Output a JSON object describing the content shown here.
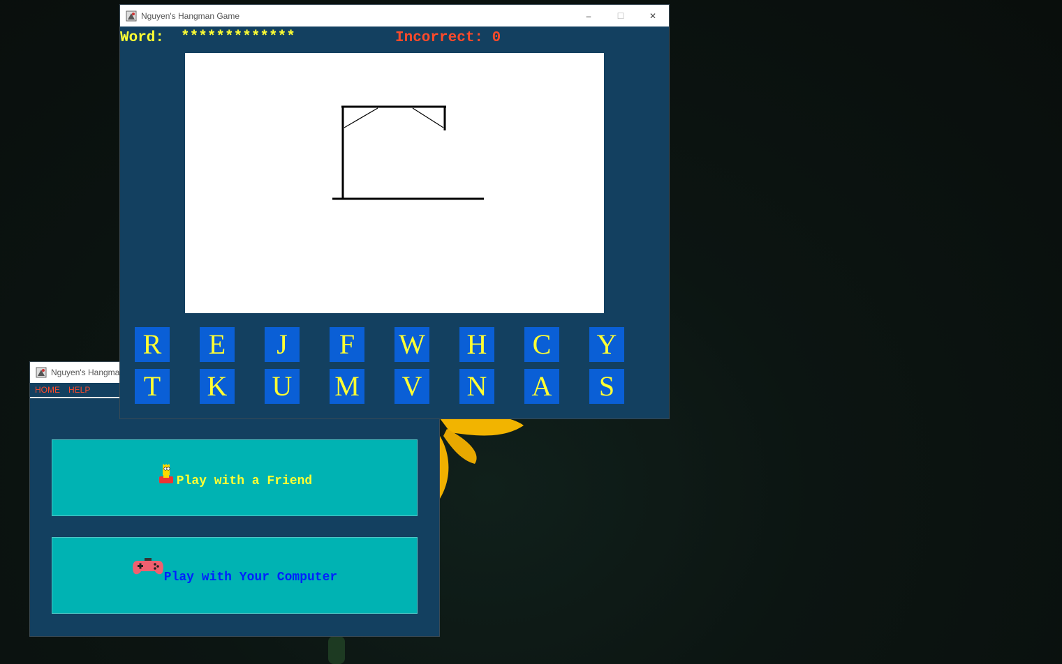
{
  "game_window": {
    "title": "Nguyen's Hangman Game",
    "controls": {
      "minimize": "–",
      "maximize": "☐",
      "close": "✕"
    },
    "word_label": "Word:",
    "word_value": "*************",
    "incorrect_label": "Incorrect: 0",
    "letters_row1": [
      "R",
      "E",
      "J",
      "F",
      "W",
      "H",
      "C",
      "Y"
    ],
    "letters_row2": [
      "T",
      "K",
      "U",
      "M",
      "V",
      "N",
      "A",
      "S"
    ]
  },
  "menu_window": {
    "title": "Nguyen's Hangma",
    "menu": [
      "HOME",
      "HELP"
    ],
    "btn_friend": {
      "label": "Play with a Friend",
      "icon": "bart-icon"
    },
    "btn_computer": {
      "label": "Play with Your Computer",
      "icon": "gamepad-icon"
    }
  },
  "colors": {
    "panel": "#134060",
    "yellow": "#ffff33",
    "red": "#ff4a2a",
    "teal": "#00b3b3",
    "letter_bg": "#0a5fd6",
    "blue_text": "#0022ff"
  }
}
